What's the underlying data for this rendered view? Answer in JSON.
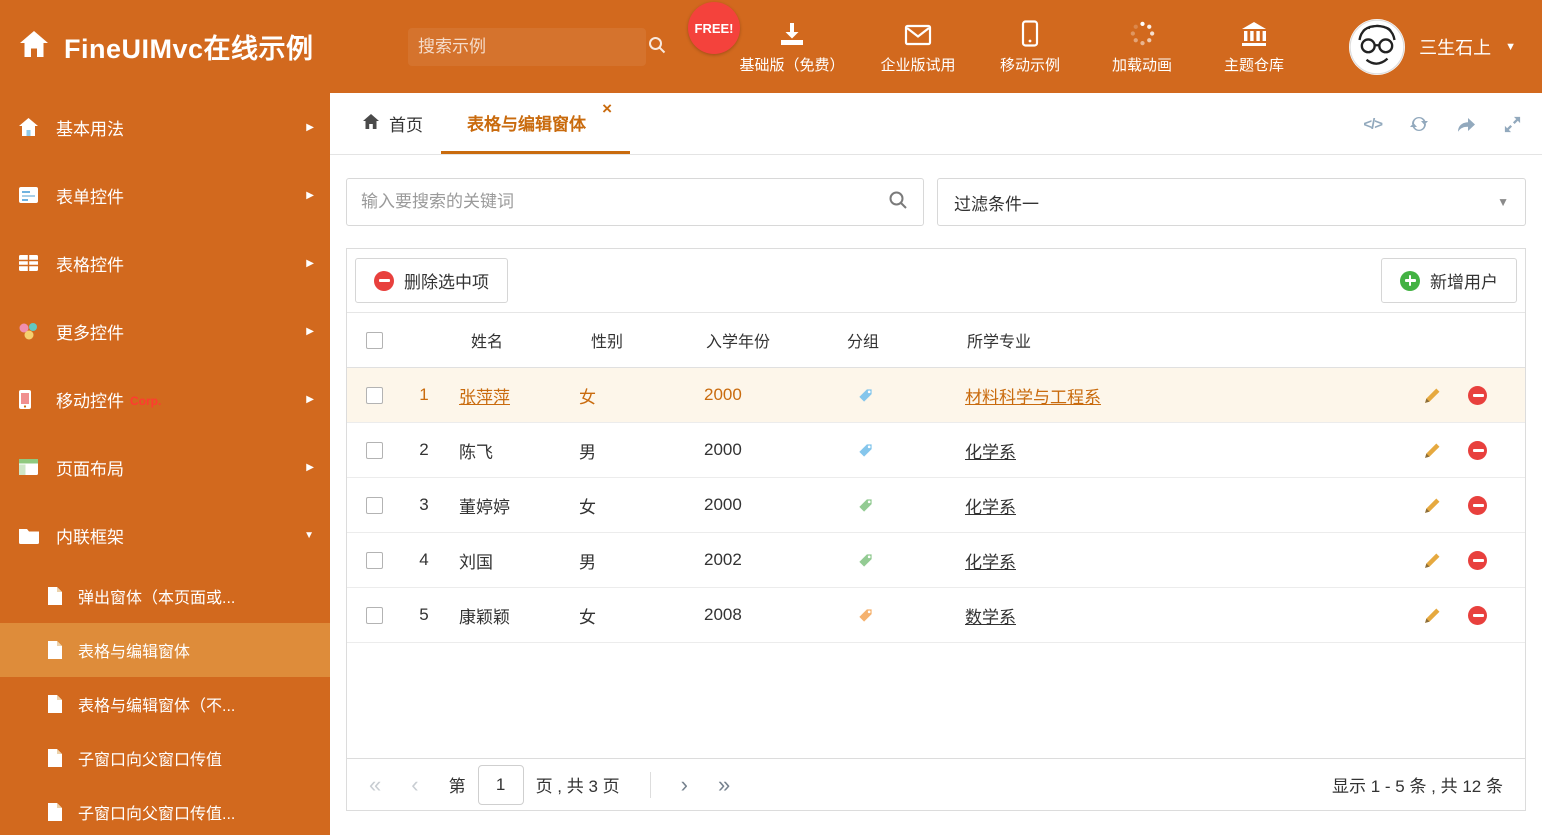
{
  "colors": {
    "accent": "#d2691e",
    "sidebar_selected": "#de8c3a",
    "accent_text": "#c96b0e",
    "danger": "#e8403d",
    "success": "#43b243",
    "row_highlight": "#fdf6ea",
    "tool_icon": "#92a9bd",
    "free_badge": "#f4423c"
  },
  "icons": {
    "caret_down": "▼",
    "chevron_right": "▶",
    "close": "×",
    "code": "</>",
    "first": "«",
    "prev": "‹",
    "next": "›",
    "last": "»"
  },
  "header": {
    "title": "FineUIMvc在线示例",
    "search_placeholder": "搜索示例",
    "free_badge": "FREE!",
    "nav": [
      {
        "label": "基础版（免费）",
        "icon": "download-icon"
      },
      {
        "label": "企业版试用",
        "icon": "envelope-icon"
      },
      {
        "label": "移动示例",
        "icon": "mobile-icon"
      },
      {
        "label": "加载动画",
        "icon": "spinner-icon"
      },
      {
        "label": "主题仓库",
        "icon": "bank-icon"
      }
    ],
    "user_name": "三生石上"
  },
  "sidebar": {
    "items": [
      {
        "label": "基本用法"
      },
      {
        "label": "表单控件"
      },
      {
        "label": "表格控件"
      },
      {
        "label": "更多控件"
      },
      {
        "label": "移动控件",
        "badge": "Corp."
      },
      {
        "label": "页面布局"
      },
      {
        "label": "内联框架"
      }
    ],
    "subitems": [
      {
        "label": "弹出窗体（本页面或..."
      },
      {
        "label": "表格与编辑窗体"
      },
      {
        "label": "表格与编辑窗体（不..."
      },
      {
        "label": "子窗口向父窗口传值"
      },
      {
        "label": "子窗口向父窗口传值..."
      }
    ]
  },
  "tabs": {
    "home": "首页",
    "active": "表格与编辑窗体"
  },
  "filter": {
    "search_placeholder": "输入要搜索的关键词",
    "dropdown_value": "过滤条件一"
  },
  "toolbar": {
    "delete_label": "删除选中项",
    "add_label": "新增用户"
  },
  "table": {
    "headers": [
      "姓名",
      "性别",
      "入学年份",
      "分组",
      "所学专业"
    ],
    "rows": [
      {
        "num": "1",
        "name": "张萍萍",
        "gender": "女",
        "year": "2000",
        "tag_color": "#85c6ec",
        "major": "材料科学与工程系"
      },
      {
        "num": "2",
        "name": "陈飞",
        "gender": "男",
        "year": "2000",
        "tag_color": "#85c6ec",
        "major": "化学系"
      },
      {
        "num": "3",
        "name": "董婷婷",
        "gender": "女",
        "year": "2000",
        "tag_color": "#93cb93",
        "major": "化学系"
      },
      {
        "num": "4",
        "name": "刘国",
        "gender": "男",
        "year": "2002",
        "tag_color": "#93cb93",
        "major": "化学系"
      },
      {
        "num": "5",
        "name": "康颖颖",
        "gender": "女",
        "year": "2008",
        "tag_color": "#f5b26f",
        "major": "数学系"
      }
    ]
  },
  "pagination": {
    "label_page": "第",
    "current": "1",
    "label_total": "页 , 共 3 页",
    "summary": "显示 1 - 5 条 , 共 12 条"
  }
}
